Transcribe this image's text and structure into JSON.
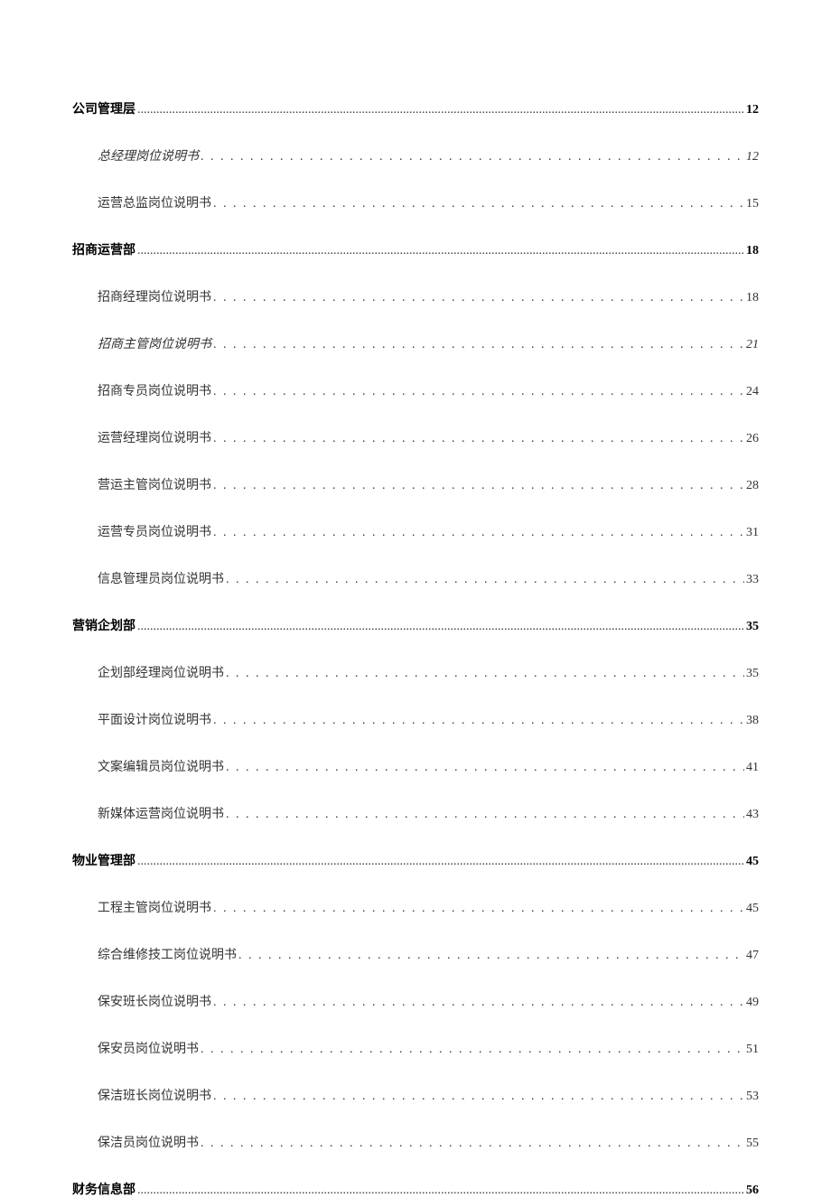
{
  "toc": [
    {
      "type": "section",
      "label": "公司管理层",
      "page": "12",
      "italic": false
    },
    {
      "type": "item",
      "label": "总经理岗位说明书",
      "page": "12",
      "italic": true
    },
    {
      "type": "item",
      "label": "运营总监岗位说明书",
      "page": "15",
      "italic": false
    },
    {
      "type": "section",
      "label": "招商运营部",
      "page": "18",
      "italic": false
    },
    {
      "type": "item",
      "label": "招商经理岗位说明书",
      "page": "18",
      "italic": false
    },
    {
      "type": "item",
      "label": "招商主管岗位说明书",
      "page": "21",
      "italic": true
    },
    {
      "type": "item",
      "label": "招商专员岗位说明书",
      "page": "24",
      "italic": false
    },
    {
      "type": "item",
      "label": "运营经理岗位说明书",
      "page": "26",
      "italic": false
    },
    {
      "type": "item",
      "label": "营运主管岗位说明书",
      "page": "28",
      "italic": false
    },
    {
      "type": "item",
      "label": "运营专员岗位说明书",
      "page": "31",
      "italic": false
    },
    {
      "type": "item",
      "label": "信息管理员岗位说明书",
      "page": "33",
      "italic": false
    },
    {
      "type": "section",
      "label": "营销企划部",
      "page": "35",
      "italic": false
    },
    {
      "type": "item",
      "label": "企划部经理岗位说明书",
      "page": "35",
      "italic": false
    },
    {
      "type": "item",
      "label": "平面设计岗位说明书",
      "page": "38",
      "italic": false
    },
    {
      "type": "item",
      "label": "文案编辑员岗位说明书",
      "page": "41",
      "italic": false
    },
    {
      "type": "item",
      "label": "新媒体运营岗位说明书",
      "page": "43",
      "italic": false
    },
    {
      "type": "section",
      "label": "物业管理部",
      "page": "45",
      "italic": false
    },
    {
      "type": "item",
      "label": "工程主管岗位说明书",
      "page": "45",
      "italic": false
    },
    {
      "type": "item",
      "label": "综合维修技工岗位说明书",
      "page": "47",
      "italic": false
    },
    {
      "type": "item",
      "label": "保安班长岗位说明书",
      "page": "49",
      "italic": false
    },
    {
      "type": "item",
      "label": "保安员岗位说明书",
      "page": "51",
      "italic": false
    },
    {
      "type": "item",
      "label": "保洁班长岗位说明书",
      "page": "53",
      "italic": false
    },
    {
      "type": "item",
      "label": "保洁员岗位说明书",
      "page": "55",
      "italic": false
    },
    {
      "type": "section",
      "label": "财务信息部",
      "page": "56",
      "italic": false
    }
  ],
  "leaderDots": ". . . . . . . . . . . . . . . . . . . . . . . . . . . . . . . . . . . . . . . . . . . . . . . . . . . . . . . . . . . . . . . . . . . . . . . . . . . . . . . . . . . . . . . . . . . . . . . . . . . . . . . . . . . . . . . . . . . . . . . . . . . . . . . . . . . . . . . . . . . . . . . . . . . . . . . . .",
  "sectionLeader": "............................................................................................................................................................................................................................................................................................"
}
